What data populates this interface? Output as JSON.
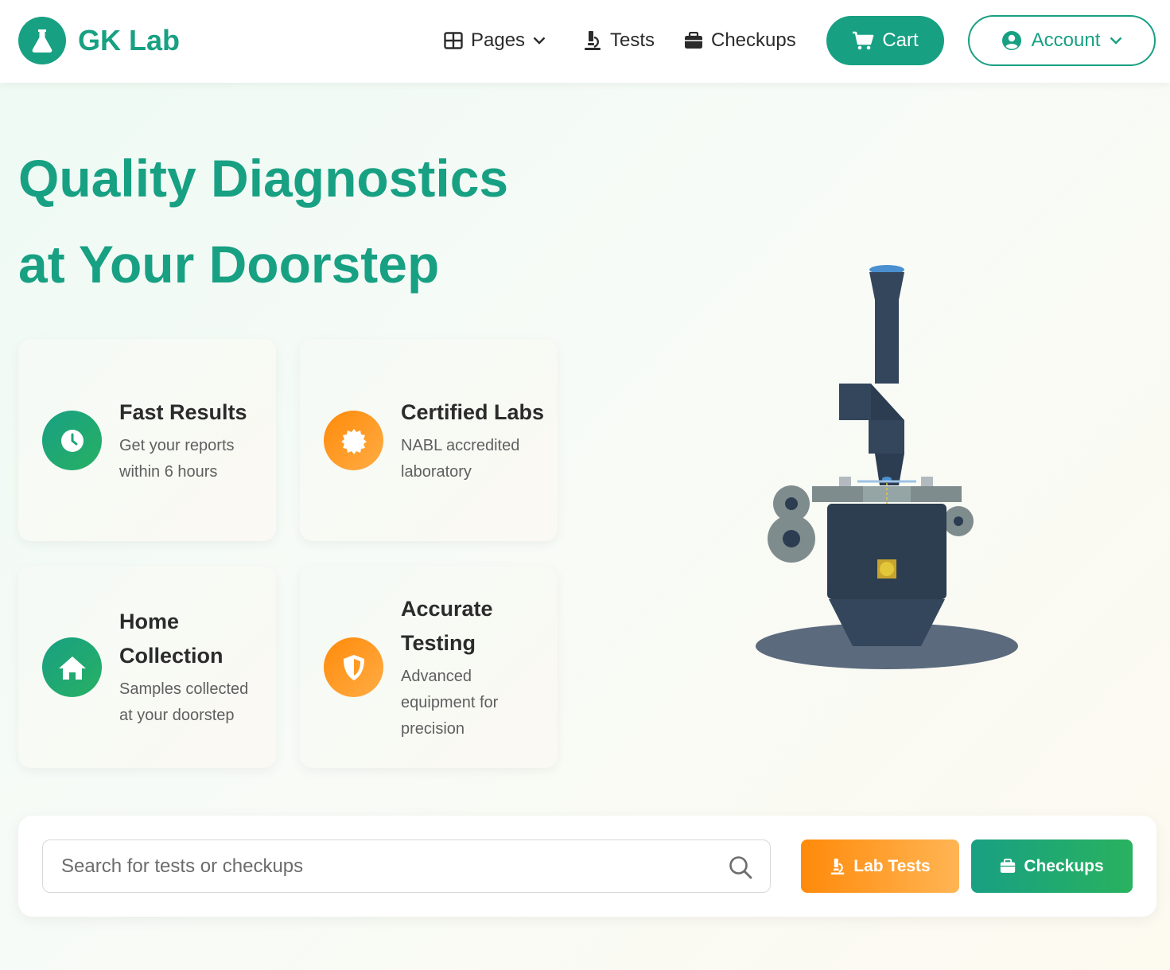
{
  "brand": {
    "name": "GK Lab",
    "logo_icon": "flask-icon"
  },
  "nav": {
    "pages": {
      "label": "Pages",
      "icon": "grid-icon"
    },
    "tests": {
      "label": "Tests",
      "icon": "microscope-icon"
    },
    "checkups": {
      "label": "Checkups",
      "icon": "briefcase-icon"
    },
    "cart": {
      "label": "Cart",
      "icon": "cart-icon"
    },
    "account": {
      "label": "Account",
      "icon": "user-circle-icon"
    }
  },
  "hero": {
    "title_line1": "Quality Diagnostics",
    "title_line2": "at Your Doorstep"
  },
  "features": [
    {
      "title": "Fast Results",
      "desc": "Get your reports within 6 hours",
      "icon": "clock-icon",
      "color": "green"
    },
    {
      "title": "Certified Labs",
      "desc": "NABL accredited laboratory",
      "icon": "certificate-icon",
      "color": "orange"
    },
    {
      "title": "Home Collection",
      "desc": "Samples collected at your doorstep",
      "icon": "home-icon",
      "color": "green"
    },
    {
      "title": "Accurate Testing",
      "desc": "Advanced equipment for precision",
      "icon": "shield-icon",
      "color": "orange"
    }
  ],
  "search": {
    "placeholder": "Search for tests or checkups",
    "value": ""
  },
  "actions": {
    "lab_tests": "Lab Tests",
    "checkups": "Checkups"
  },
  "colors": {
    "primary": "#18a083",
    "accent": "#ff8a0a",
    "text": "#2b2b2b",
    "muted": "#5f5f5f"
  }
}
